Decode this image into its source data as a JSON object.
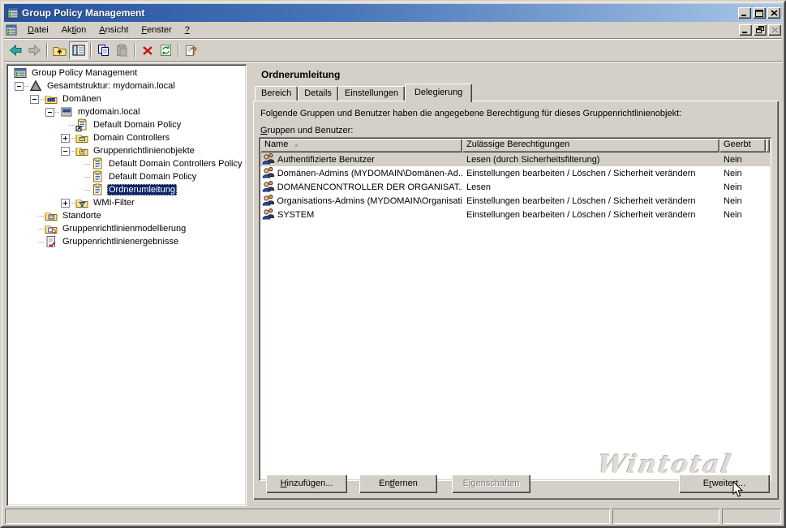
{
  "window": {
    "title": "Group Policy Management",
    "title_icon": "gpmc-app-icon",
    "statusbar": {
      "panels": [
        "",
        "",
        ""
      ]
    }
  },
  "menubar": {
    "items": [
      {
        "name": "menu-datei",
        "pre": "",
        "accel": "D",
        "post": "atei"
      },
      {
        "name": "menu-aktion",
        "pre": "Ak",
        "accel": "ti",
        "post": "on"
      },
      {
        "name": "menu-ansicht",
        "pre": "",
        "accel": "A",
        "post": "nsicht"
      },
      {
        "name": "menu-fenster",
        "pre": "",
        "accel": "F",
        "post": "enster"
      },
      {
        "name": "menu-hilfe",
        "pre": "",
        "accel": "?",
        "post": ""
      }
    ]
  },
  "toolbar": {
    "items": [
      {
        "icon": "back-icon",
        "disabled": false,
        "pressed": false
      },
      {
        "icon": "forward-icon",
        "disabled": true,
        "pressed": false
      },
      {
        "icon": "separator"
      },
      {
        "icon": "up-one-level-icon",
        "disabled": false,
        "pressed": false
      },
      {
        "icon": "show-console-tree-icon",
        "disabled": false,
        "pressed": true
      },
      {
        "icon": "separator"
      },
      {
        "icon": "copy-icon",
        "disabled": false,
        "pressed": false
      },
      {
        "icon": "paste-icon",
        "disabled": true,
        "pressed": false
      },
      {
        "icon": "separator"
      },
      {
        "icon": "delete-icon",
        "disabled": false,
        "pressed": false
      },
      {
        "icon": "refresh-icon",
        "disabled": false,
        "pressed": false
      },
      {
        "icon": "separator"
      },
      {
        "icon": "help-icon",
        "disabled": false,
        "pressed": false
      }
    ]
  },
  "tree": {
    "items": [
      {
        "label": "Group Policy Management",
        "depth": 0,
        "expand": null,
        "icon": "gpmc-root-icon",
        "selected": false
      },
      {
        "label": "Gesamtstruktur: mydomain.local",
        "depth": 1,
        "expand": "minus",
        "icon": "forest-icon",
        "selected": false
      },
      {
        "label": "Domänen",
        "depth": 2,
        "expand": "minus",
        "icon": "domains-folder-icon",
        "selected": false
      },
      {
        "label": "mydomain.local",
        "depth": 3,
        "expand": "minus",
        "icon": "domain-icon",
        "selected": false
      },
      {
        "label": "Default Domain Policy",
        "depth": 4,
        "expand": null,
        "icon": "gpo-link-icon",
        "selected": false
      },
      {
        "label": "Domain Controllers",
        "depth": 4,
        "expand": "plus",
        "icon": "ou-folder-icon",
        "selected": false
      },
      {
        "label": "Gruppenrichtlinienobjekte",
        "depth": 4,
        "expand": "minus",
        "icon": "gpo-folder-icon",
        "selected": false
      },
      {
        "label": "Default Domain Controllers Policy",
        "depth": 5,
        "expand": null,
        "icon": "gpo-icon",
        "selected": false
      },
      {
        "label": "Default Domain Policy",
        "depth": 5,
        "expand": null,
        "icon": "gpo-icon",
        "selected": false
      },
      {
        "label": "Ordnerumleitung",
        "depth": 5,
        "expand": null,
        "icon": "gpo-icon",
        "selected": true
      },
      {
        "label": "WMI-Filter",
        "depth": 4,
        "expand": "plus",
        "icon": "wmi-folder-icon",
        "selected": false
      },
      {
        "label": "Standorte",
        "depth": 2,
        "expand": null,
        "icon": "sites-folder-icon",
        "selected": false
      },
      {
        "label": "Gruppenrichtlinienmodellierung",
        "depth": 2,
        "expand": null,
        "icon": "modeling-icon",
        "selected": false
      },
      {
        "label": "Gruppenrichtlinienergebnisse",
        "depth": 2,
        "expand": null,
        "icon": "results-icon",
        "selected": false
      }
    ]
  },
  "main": {
    "title": "Ordnerumleitung",
    "tabs": [
      {
        "name": "tab-bereich",
        "label": "Bereich",
        "active": false
      },
      {
        "name": "tab-details",
        "label": "Details",
        "active": false
      },
      {
        "name": "tab-einstellungen",
        "label": "Einstellungen",
        "active": false
      },
      {
        "name": "tab-delegierung",
        "label": "Delegierung",
        "active": true
      }
    ],
    "description": "Folgende Gruppen und Benutzer haben die angegebene Berechtigung für dieses Gruppenrichtlinienobjekt:",
    "list_label": {
      "pre": "",
      "accel": "G",
      "post": "ruppen und Benutzer:"
    },
    "table": {
      "columns": [
        "Name",
        "Zulässige Berechtigungen",
        "Geerbt"
      ],
      "sort_column": "Name",
      "sort_icon": "sort-ascending-icon",
      "row_icon": "group-icon",
      "rows": [
        {
          "name": "Authentifizierte Benutzer",
          "permission": "Lesen (durch Sicherheitsfilterung)",
          "inherited": "Nein",
          "selected": true
        },
        {
          "name": "Domänen-Admins (MYDOMAIN\\Domänen-Ad...",
          "permission": "Einstellungen bearbeiten / Löschen / Sicherheit verändern",
          "inherited": "Nein",
          "selected": false
        },
        {
          "name": "DOMÄNENCONTROLLER DER ORGANISAT...",
          "permission": "Lesen",
          "inherited": "Nein",
          "selected": false
        },
        {
          "name": "Organisations-Admins (MYDOMAIN\\Organisati...",
          "permission": "Einstellungen bearbeiten / Löschen / Sicherheit verändern",
          "inherited": "Nein",
          "selected": false
        },
        {
          "name": "SYSTEM",
          "permission": "Einstellungen bearbeiten / Löschen / Sicherheit verändern",
          "inherited": "Nein",
          "selected": false
        }
      ]
    },
    "buttons": [
      {
        "name": "add-button",
        "pre": "",
        "accel": "H",
        "post": "inzufügen...",
        "disabled": false,
        "pos": "btn-add"
      },
      {
        "name": "remove-button",
        "pre": "En",
        "accel": "tf",
        "post": "ernen",
        "disabled": false,
        "pos": "btn-remove"
      },
      {
        "name": "properties-button",
        "pre": "E",
        "accel": "i",
        "post": "genschaften",
        "disabled": true,
        "pos": "btn-props"
      },
      {
        "name": "advanced-button",
        "pre": "E",
        "accel": "r",
        "post": "weitert...",
        "disabled": false,
        "pos": "btn-adv"
      }
    ],
    "watermark": "Wintotal"
  },
  "colors": {
    "titlebar_left": "#26519E",
    "titlebar_right": "#A9C6E8",
    "selection": "#0A246A",
    "face": "#D4D0C8"
  }
}
